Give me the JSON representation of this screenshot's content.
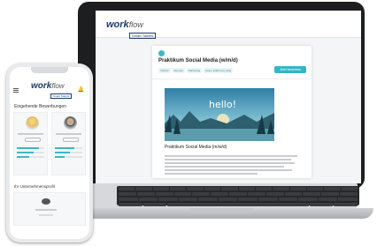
{
  "brand": {
    "name": "work",
    "name_accent": "flow",
    "sublabel": "Smart Talents"
  },
  "desktop": {
    "job": {
      "title": "Praktikum Social Media (w/m/d)",
      "chips": [
        "Vollzeit",
        "Remote",
        "Marketing",
        "Keine Erfahrung nötig"
      ],
      "apply_label": "Jetzt bewerben",
      "hero_text": "hello!",
      "caption": "Praktikum Social Media (m/w/d)"
    }
  },
  "phone": {
    "section_applications": "Eingehende Bewerbungen",
    "section_employer": "Ihr Unternehmensprofil",
    "profile_bars": [
      [
        0.8,
        0.6,
        0.45
      ],
      [
        0.7,
        0.55,
        0.35
      ]
    ]
  },
  "colors": {
    "accent": "#3fb6c8",
    "brand": "#1c3b6e"
  }
}
